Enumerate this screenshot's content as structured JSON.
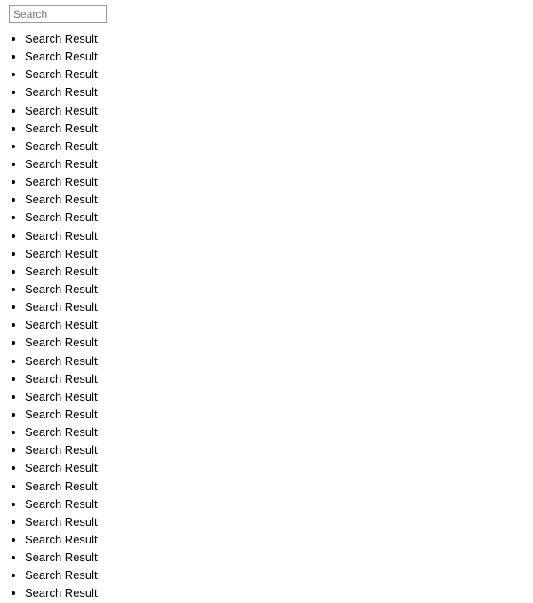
{
  "search": {
    "placeholder": "Search",
    "value": ""
  },
  "results": {
    "item_label": "Search Result:",
    "items": [
      "Search Result:",
      "Search Result:",
      "Search Result:",
      "Search Result:",
      "Search Result:",
      "Search Result:",
      "Search Result:",
      "Search Result:",
      "Search Result:",
      "Search Result:",
      "Search Result:",
      "Search Result:",
      "Search Result:",
      "Search Result:",
      "Search Result:",
      "Search Result:",
      "Search Result:",
      "Search Result:",
      "Search Result:",
      "Search Result:",
      "Search Result:",
      "Search Result:",
      "Search Result:",
      "Search Result:",
      "Search Result:",
      "Search Result:",
      "Search Result:",
      "Search Result:",
      "Search Result:",
      "Search Result:",
      "Search Result:",
      "Search Result:"
    ]
  }
}
